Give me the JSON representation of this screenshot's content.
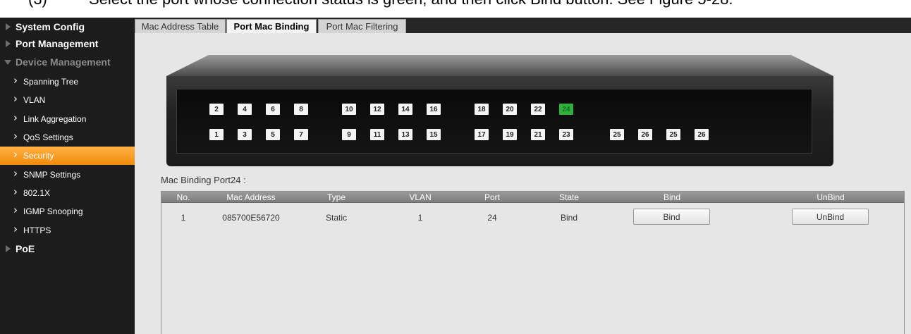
{
  "caption": {
    "step": "(3)",
    "text": "Select the port whose connection status is green, and then click Bind button. See Figure 5-28."
  },
  "sidebar": {
    "items": [
      {
        "label": "System Config",
        "kind": "top"
      },
      {
        "label": "Port Management",
        "kind": "top"
      },
      {
        "label": "Device Management",
        "kind": "top-open"
      },
      {
        "label": "Spanning Tree",
        "kind": "sub"
      },
      {
        "label": "VLAN",
        "kind": "sub"
      },
      {
        "label": "Link Aggregation",
        "kind": "sub"
      },
      {
        "label": "QoS Settings",
        "kind": "sub"
      },
      {
        "label": "Security",
        "kind": "sub",
        "active": true
      },
      {
        "label": "SNMP Settings",
        "kind": "sub"
      },
      {
        "label": "802.1X",
        "kind": "sub"
      },
      {
        "label": "IGMP Snooping",
        "kind": "sub"
      },
      {
        "label": "HTTPS",
        "kind": "sub"
      },
      {
        "label": "PoE",
        "kind": "top"
      }
    ]
  },
  "tabs": [
    {
      "label": "Mac Address Table",
      "active": false
    },
    {
      "label": "Port Mac Binding",
      "active": true
    },
    {
      "label": "Port Mac Filtering",
      "active": false
    }
  ],
  "switch": {
    "top_row": [
      "2",
      "4",
      "6",
      "8",
      "10",
      "12",
      "14",
      "16",
      "18",
      "20",
      "22",
      "24"
    ],
    "bottom_row": [
      "1",
      "3",
      "5",
      "7",
      "9",
      "11",
      "13",
      "15",
      "17",
      "19",
      "21",
      "23"
    ],
    "extra_ports": [
      "25",
      "26",
      "25",
      "26"
    ],
    "active_port": "24",
    "active_color": "#2db33a"
  },
  "binding": {
    "title": "Mac Binding Port24 :",
    "columns": [
      "No.",
      "Mac Address",
      "Type",
      "VLAN",
      "Port",
      "State",
      "Bind",
      "UnBind"
    ],
    "rows": [
      {
        "no": "1",
        "mac": "085700E56720",
        "type": "Static",
        "vlan": "1",
        "port": "24",
        "state": "Bind",
        "bind_label": "Bind",
        "unbind_label": "UnBind"
      }
    ]
  },
  "colors": {
    "sidebar_bg": "#1c1c1c",
    "active_item": "#f28a0b",
    "header_bar": "#262626"
  }
}
